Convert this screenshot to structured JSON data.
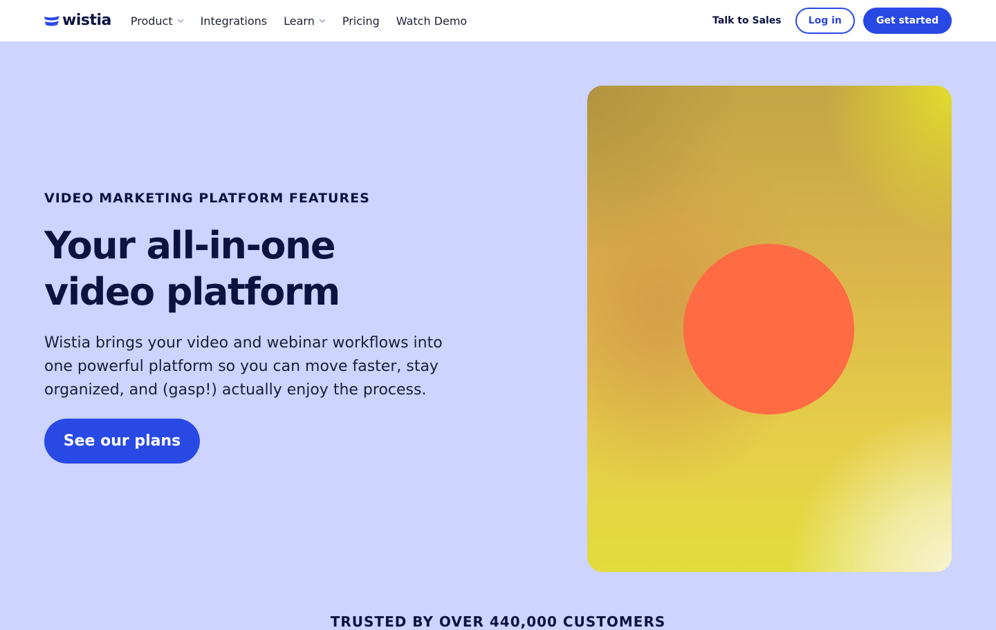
{
  "nav": {
    "logo_text": "wistia",
    "links": [
      {
        "label": "Product",
        "has_dropdown": true
      },
      {
        "label": "Integrations",
        "has_dropdown": false
      },
      {
        "label": "Learn",
        "has_dropdown": true
      },
      {
        "label": "Pricing",
        "has_dropdown": false
      },
      {
        "label": "Watch Demo",
        "has_dropdown": false
      }
    ],
    "talk_to_sales": "Talk to Sales",
    "login": "Log in",
    "get_started": "Get started"
  },
  "hero": {
    "eyebrow": "VIDEO MARKETING PLATFORM FEATURES",
    "headline_line1": "Your all-in-one",
    "headline_line2": "video platform",
    "body": "Wistia brings your video and webinar workflows into one powerful platform so you can move faster, stay organized, and (gasp!) actually enjoy the process.",
    "cta": "See our plans"
  },
  "trusted": "TRUSTED BY OVER 440,000 CUSTOMERS",
  "colors": {
    "brand_blue": "#2949e5",
    "page_background": "#ccd4ff",
    "text_navy": "#0b1340",
    "art_circle": "#ff6b42"
  },
  "icons": {
    "logo": "wistia-logo-icon",
    "dropdown": "chevron-down-icon"
  }
}
